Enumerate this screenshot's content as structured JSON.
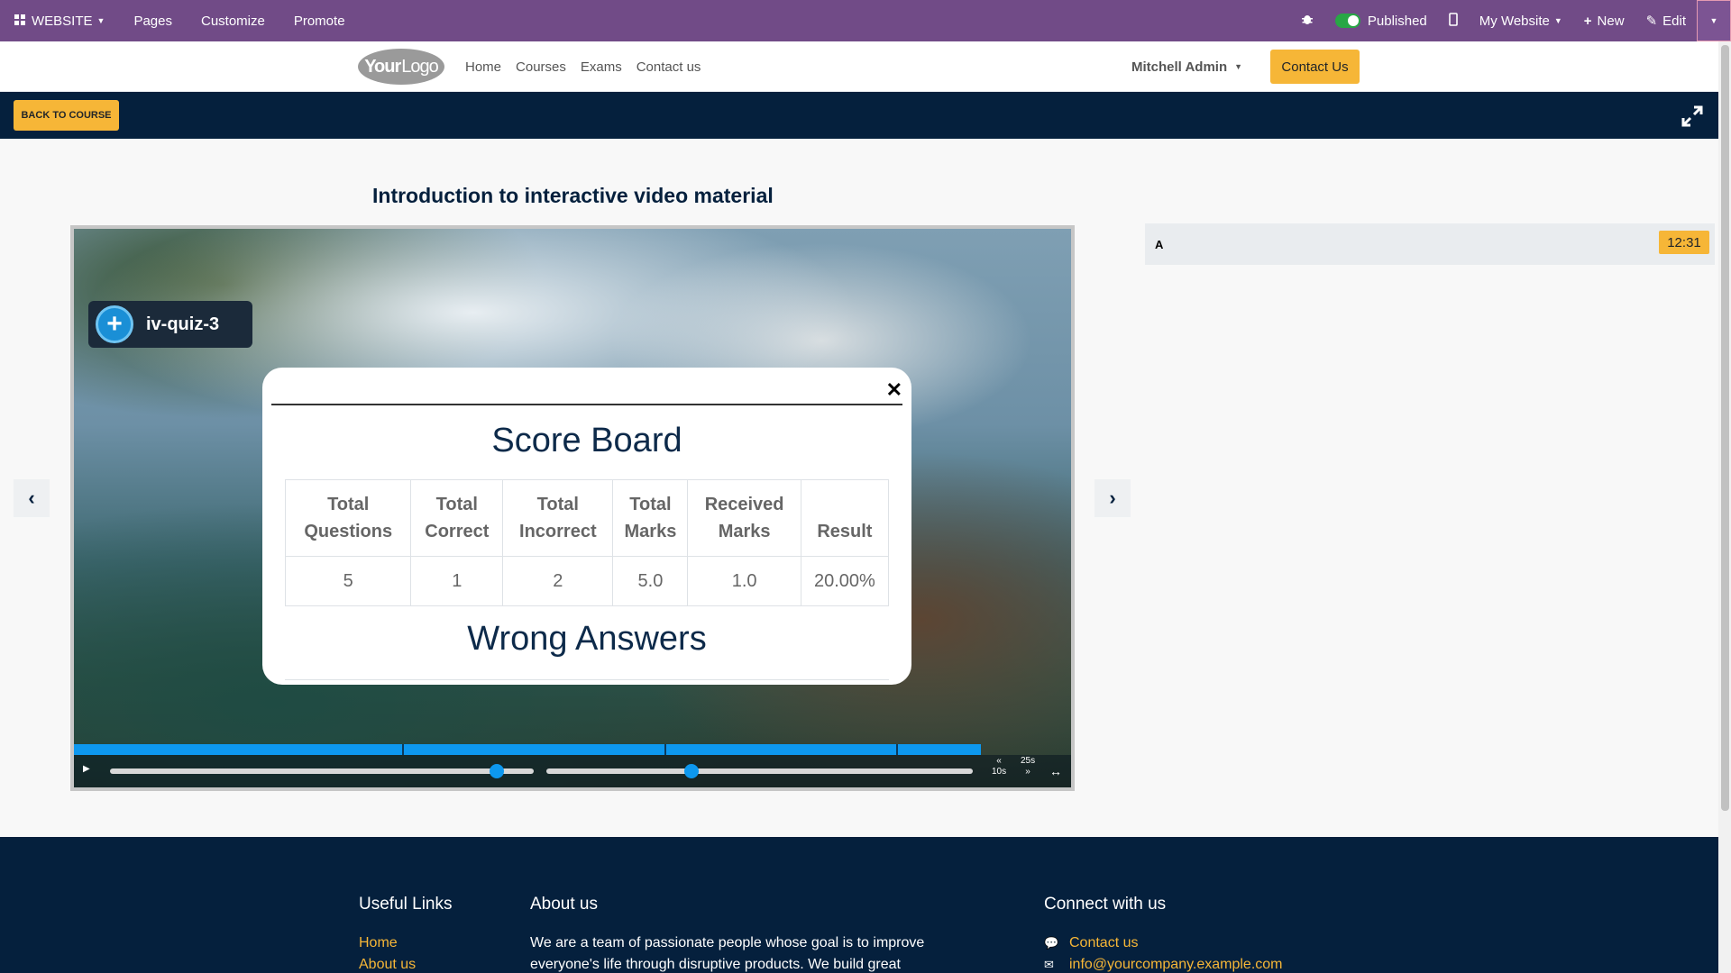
{
  "admin_bar": {
    "website_label": "WEBSITE",
    "pages_label": "Pages",
    "customize_label": "Customize",
    "promote_label": "Promote",
    "published_label": "Published",
    "my_website_label": "My Website",
    "new_label": "New",
    "edit_label": "Edit"
  },
  "header": {
    "logo_text_a": "Your",
    "logo_text_b": "Logo",
    "nav": [
      "Home",
      "Courses",
      "Exams",
      "Contact us"
    ],
    "user_name": "Mitchell Admin",
    "contact_button": "Contact Us"
  },
  "course_bar": {
    "back_label": "BACK TO COURSE"
  },
  "lesson": {
    "title": "Introduction to interactive video material"
  },
  "player": {
    "quiz_tag": "iv-quiz-3",
    "skip_forward": "25s",
    "skip_back": "10s"
  },
  "scoreboard": {
    "title": "Score Board",
    "headers": [
      [
        "Total",
        "Questions"
      ],
      [
        "Total",
        "Correct"
      ],
      [
        "Total",
        "Incorrect"
      ],
      [
        "Total",
        "Marks"
      ],
      [
        "Received",
        "Marks"
      ],
      [
        "Result",
        ""
      ]
    ],
    "values": [
      "5",
      "1",
      "2",
      "5.0",
      "1.0",
      "20.00%"
    ],
    "wrong_answers_title": "Wrong Answers"
  },
  "side_panel": {
    "label": "A",
    "time": "12:31"
  },
  "footer": {
    "useful_links_title": "Useful Links",
    "links": [
      "Home",
      "About us"
    ],
    "about_title": "About us",
    "about_text": "We are a team of passionate people whose goal is to improve everyone's life through disruptive products. We build great",
    "connect_title": "Connect with us",
    "connect_items": [
      "Contact us",
      "info@yourcompany.example.com"
    ]
  },
  "colors": {
    "admin_bar": "#714b87",
    "accent": "#f6b637",
    "navy": "#05203d",
    "progress": "#0d98ef"
  }
}
